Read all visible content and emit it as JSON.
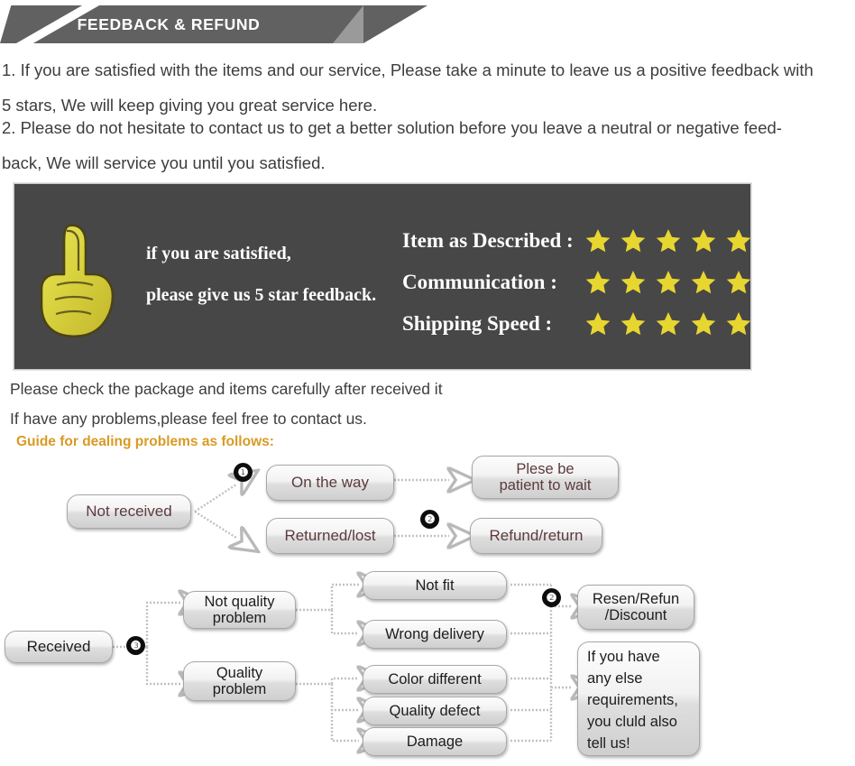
{
  "header": {
    "title": "FEEDBACK & REFUND"
  },
  "intro": {
    "paragraph_1": "1. If you are satisfied with the items and our service, Please take a minute to leave us a positive feedback with\n5 stars, We will keep giving you great service here.",
    "paragraph_2": "2. Please do not hesitate to contact us to get a better solution before you leave a neutral or negative feed-\nback, We will service you until you satisfied."
  },
  "feedback_banner": {
    "background_color": "#474747",
    "thumb_icon": "thumbs-up-icon",
    "thumb_color": "#d9d441",
    "line_1": "if you are satisfied,",
    "line_2": "please give us 5 star feedback.",
    "star_color": "#e8d630",
    "ratings": [
      {
        "label": "Item as Described :",
        "stars": 5
      },
      {
        "label": "Communication :",
        "stars": 5
      },
      {
        "label": "Shipping Speed :",
        "stars": 5
      }
    ]
  },
  "notes": {
    "line_1": "Please check the package and items carefully after received it",
    "line_2": "If have any problems,please feel free to contact us.",
    "guide_heading": "Guide for dealing problems as follows:",
    "guide_color": "#d99a24"
  },
  "flow_not_received": {
    "root": "Not received",
    "branches": [
      {
        "badge": "❶",
        "from": "On the way",
        "to": "Plese be\npatient to wait"
      },
      {
        "badge": "❷",
        "from": "Returned/lost",
        "to": "Refund/return"
      }
    ],
    "boxes": {
      "not_received": "Not received",
      "on_the_way": "On the way",
      "returned_lost": "Returned/lost",
      "plese_be_patient": "Plese be\npatient to wait",
      "refund_return": "Refund/return"
    },
    "badges": {
      "one": "❶",
      "two": "❷"
    }
  },
  "flow_received": {
    "root": "Received",
    "badge_root": "❸",
    "badge_result": "❷",
    "categories": [
      {
        "name": "Not quality\nproblem",
        "reasons": [
          "Not fit",
          "Wrong delivery"
        ]
      },
      {
        "name": "Quality\nproblem",
        "reasons": [
          "Color different",
          "Quality defect",
          "Damage"
        ]
      }
    ],
    "outcomes": [
      "Resen/Refun\n/Discount",
      "If you have\nany else\nrequirements,\nyou cluld also\ntell us!"
    ],
    "boxes": {
      "received": "Received",
      "not_quality_problem": "Not quality\nproblem",
      "quality_problem": "Quality\nproblem",
      "not_fit": "Not fit",
      "wrong_delivery": "Wrong delivery",
      "color_different": "Color different",
      "quality_defect": "Quality defect",
      "damage": "Damage",
      "resend": "Resen/Refun\n/Discount",
      "tell_us": "If you have\nany else\nrequirements,\nyou cluld also\ntell us!"
    }
  }
}
